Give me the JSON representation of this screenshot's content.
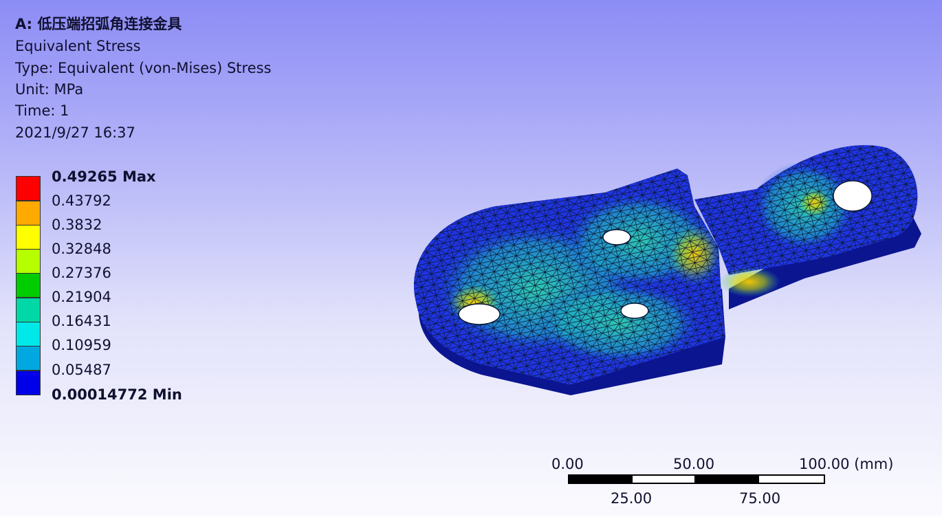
{
  "header": {
    "title": "A: 低压端招弧角连接金具",
    "result_name": "Equivalent Stress",
    "type_line": "Type: Equivalent (von-Mises) Stress",
    "unit_line": "Unit: MPa",
    "time_line": "Time: 1",
    "timestamp": "2021/9/27 16:37"
  },
  "legend": {
    "max_label": "0.49265 Max",
    "min_label": "0.00014772 Min",
    "levels": [
      "0.43792",
      "0.3832",
      "0.32848",
      "0.27376",
      "0.21904",
      "0.16431",
      "0.10959",
      "0.05487"
    ],
    "colors": [
      "#ff0000",
      "#ffaa00",
      "#ffff00",
      "#b6ff00",
      "#00cc00",
      "#00d8a8",
      "#00e8e8",
      "#00a8e0",
      "#0000e8"
    ]
  },
  "scale_bar": {
    "top_labels": [
      "0.00",
      "50.00",
      "100.00 (mm)"
    ],
    "bottom_labels": [
      "25.00",
      "75.00"
    ]
  },
  "colors": {
    "background_top": "#8c8cf6",
    "background_bottom": "#fbfbfe",
    "model_low": "#1a2ae0",
    "model_mid": "#1fb8b8",
    "model_high": "#ffd000"
  }
}
